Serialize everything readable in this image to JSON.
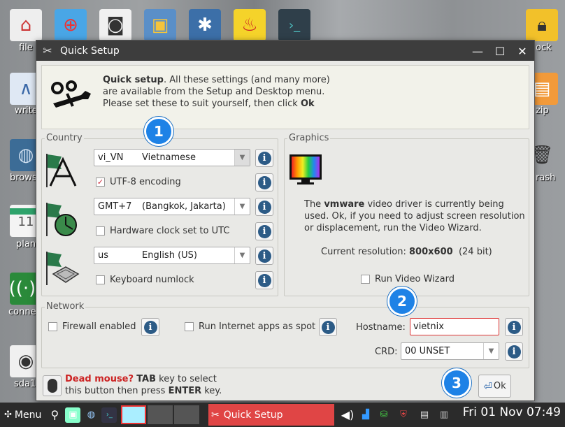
{
  "desktop": {
    "icons": [
      {
        "label": "file"
      },
      {
        "label": "write"
      },
      {
        "label": "brows"
      },
      {
        "label": "plan"
      },
      {
        "label": "conne"
      },
      {
        "label": "sda1"
      },
      {
        "label": "ock"
      },
      {
        "label": "zip"
      },
      {
        "label": "rash"
      }
    ],
    "calendar_day": "11"
  },
  "window": {
    "title": "Quick Setup",
    "intro": {
      "bold_lead": "Quick setup",
      "text": ". All these settings (and many more) are available from the Setup and Desktop menu. Please set these to suit yourself, then click ",
      "bold_tail": "Ok"
    },
    "country": {
      "legend": "Country",
      "locale_code": "vi_VN",
      "locale_name": "Vietnamese",
      "utf8_label": "UTF-8 encoding",
      "utf8_checked": true,
      "timezone_code": "GMT+7",
      "timezone_name": "(Bangkok, Jakarta)",
      "hwclock_label": "Hardware clock set to UTC",
      "keyboard_code": "us",
      "keyboard_name": "English (US)",
      "numlock_label": "Keyboard numlock"
    },
    "graphics": {
      "legend": "Graphics",
      "desc_pre": "The ",
      "driver": "vmware",
      "desc_post": " video driver is currently being used. Ok, if you need to adjust screen resolution or displacement, run the Video Wizard.",
      "res_label": "Current resolution:",
      "res_value": "800x600",
      "res_bits": "(24 bit)",
      "wizard_label": "Run Video Wizard"
    },
    "network": {
      "legend": "Network",
      "firewall_label": "Firewall enabled",
      "spot_label": "Run Internet apps as spot",
      "hostname_label": "Hostname:",
      "hostname_value": "vietnix",
      "crd_label": "CRD:",
      "crd_value": "00 UNSET"
    },
    "footer": {
      "bold1": "Dead mouse?",
      "text1": " ",
      "bold2": "TAB",
      "text2": " key to select this button then press ",
      "bold3": "ENTER",
      "text3": " key.",
      "ok_label": "Ok"
    },
    "badges": [
      "1",
      "2",
      "3"
    ]
  },
  "taskbar": {
    "menu_label": "Menu",
    "task_label": "Quick Setup",
    "clock": "Fri 01 Nov 07:49"
  },
  "colors": {
    "accent_badge": "#1e82e6",
    "task_active": "#e04545",
    "hostname_border": "#dd3333"
  }
}
